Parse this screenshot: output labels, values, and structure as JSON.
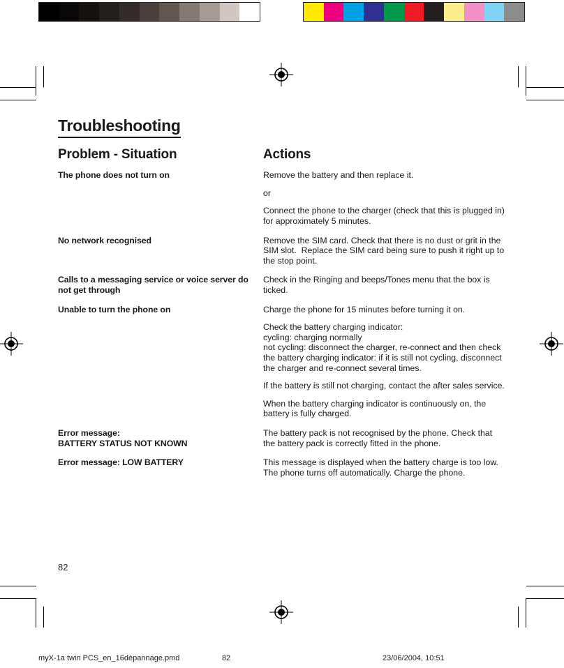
{
  "calibration": {
    "grayscale_label": "grayscale-calibration-bar",
    "grayscale_swatches": [
      "#000000",
      "#0a0807",
      "#15110f",
      "#241e1c",
      "#332b28",
      "#4a403c",
      "#625651",
      "#837872",
      "#a69a95",
      "#d0c6c2",
      "#ffffff"
    ],
    "color_label": "color-calibration-bar",
    "color_swatches": [
      "#ffe900",
      "#ec0080",
      "#00a0e4",
      "#2e3191",
      "#00984a",
      "#ed1c24",
      "#231f20",
      "#fcee8c",
      "#f490c8",
      "#7fd4f4",
      "#8c8c8c"
    ]
  },
  "document": {
    "title": "Troubleshooting",
    "page_number": "82"
  },
  "table": {
    "headers": {
      "problem": "Problem - Situation",
      "actions": "Actions"
    },
    "rows": [
      {
        "problem": "The phone does not turn on",
        "actions": [
          {
            "text": "Remove the battery and then replace it."
          },
          {
            "text": "or"
          },
          {
            "text": "Connect the phone to the charger (check that this is plugged in) for approximately 5 minutes."
          }
        ]
      },
      {
        "problem": "No network recognised",
        "actions": [
          {
            "text": "Remove the SIM card. Check that there is no dust or grit in the SIM slot.  Replace the SIM card being sure to push it right up to the stop point."
          }
        ]
      },
      {
        "problem": "Calls to a messaging service or voice server do not get through",
        "actions": [
          {
            "text": "Check in the Ringing and beeps/Tones menu that the box is ticked."
          }
        ]
      },
      {
        "problem": "Unable to turn the phone on",
        "actions": [
          {
            "text": "Charge the phone for 15 minutes before turning it on."
          },
          {
            "text": "Check the battery charging indicator:\ncycling: charging normally\nnot cycling: disconnect the charger, re-connect and then check the battery charging indicator: if it is still not cycling, disconnect the charger and re-connect several times."
          },
          {
            "text": "If the battery is still not charging, contact the after sales service."
          },
          {
            "text": "When the battery charging indicator is continuously on, the battery is fully charged."
          }
        ]
      },
      {
        "problem": "Error message:\nBATTERY STATUS NOT KNOWN",
        "actions": [
          {
            "text": "The battery pack is not recognised by the phone. Check that the battery pack is correctly fitted in the phone."
          }
        ]
      },
      {
        "problem": "Error message: LOW BATTERY",
        "actions": [
          {
            "text": "This message is displayed when the battery charge is too low. The phone turns off automatically. Charge the phone."
          }
        ]
      }
    ]
  },
  "footer": {
    "filename": "myX-1a twin PCS_en_16dépannage.pmd",
    "page": "82",
    "timestamp": "23/06/2004, 10:51"
  }
}
